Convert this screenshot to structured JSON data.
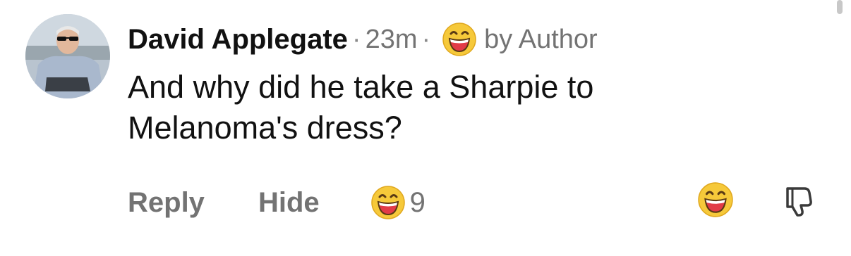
{
  "comment": {
    "author": "David Applegate",
    "separator": "·",
    "time": "23m",
    "author_badge": "by Author",
    "badge_icon": "grinning-face-icon",
    "text": "And why did he take a Sharpie to Melanoma's dress?"
  },
  "actions": {
    "reply_label": "Reply",
    "hide_label": "Hide",
    "reaction_icon": "grinning-face-icon",
    "reaction_count": "9",
    "react_icon": "grinning-face-icon",
    "dislike_icon": "thumbs-down-icon"
  },
  "colors": {
    "text": "#111111",
    "muted": "#737373",
    "emoji_face": "#f6c93a",
    "emoji_mouth": "#e23b47"
  }
}
